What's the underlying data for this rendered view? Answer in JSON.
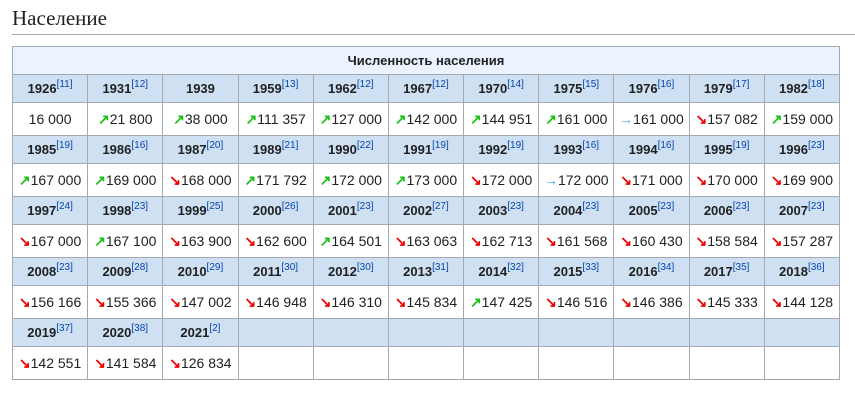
{
  "heading": "Население",
  "table_title": "Численность населения",
  "colors": {
    "up": "#19c019",
    "down": "#ee0000",
    "same": "#3aa6f0"
  },
  "rows": [
    [
      {
        "year": "1926",
        "ref": "[11]",
        "trend": "none",
        "value": "16 000"
      },
      {
        "year": "1931",
        "ref": "[12]",
        "trend": "up",
        "value": "21 800"
      },
      {
        "year": "1939",
        "ref": "",
        "trend": "up",
        "value": "38 000"
      },
      {
        "year": "1959",
        "ref": "[13]",
        "trend": "up",
        "value": "111 357"
      },
      {
        "year": "1962",
        "ref": "[12]",
        "trend": "up",
        "value": "127 000"
      },
      {
        "year": "1967",
        "ref": "[12]",
        "trend": "up",
        "value": "142 000"
      },
      {
        "year": "1970",
        "ref": "[14]",
        "trend": "up",
        "value": "144 951"
      },
      {
        "year": "1975",
        "ref": "[15]",
        "trend": "up",
        "value": "161 000"
      },
      {
        "year": "1976",
        "ref": "[16]",
        "trend": "same",
        "value": "161 000"
      },
      {
        "year": "1979",
        "ref": "[17]",
        "trend": "down",
        "value": "157 082"
      },
      {
        "year": "1982",
        "ref": "[18]",
        "trend": "up",
        "value": "159 000"
      }
    ],
    [
      {
        "year": "1985",
        "ref": "[19]",
        "trend": "up",
        "value": "167 000"
      },
      {
        "year": "1986",
        "ref": "[16]",
        "trend": "up",
        "value": "169 000"
      },
      {
        "year": "1987",
        "ref": "[20]",
        "trend": "down",
        "value": "168 000"
      },
      {
        "year": "1989",
        "ref": "[21]",
        "trend": "up",
        "value": "171 792"
      },
      {
        "year": "1990",
        "ref": "[22]",
        "trend": "up",
        "value": "172 000"
      },
      {
        "year": "1991",
        "ref": "[19]",
        "trend": "up",
        "value": "173 000"
      },
      {
        "year": "1992",
        "ref": "[19]",
        "trend": "down",
        "value": "172 000"
      },
      {
        "year": "1993",
        "ref": "[16]",
        "trend": "same",
        "value": "172 000"
      },
      {
        "year": "1994",
        "ref": "[16]",
        "trend": "down",
        "value": "171 000"
      },
      {
        "year": "1995",
        "ref": "[19]",
        "trend": "down",
        "value": "170 000"
      },
      {
        "year": "1996",
        "ref": "[23]",
        "trend": "down",
        "value": "169 900"
      }
    ],
    [
      {
        "year": "1997",
        "ref": "[24]",
        "trend": "down",
        "value": "167 000"
      },
      {
        "year": "1998",
        "ref": "[23]",
        "trend": "up",
        "value": "167 100"
      },
      {
        "year": "1999",
        "ref": "[25]",
        "trend": "down",
        "value": "163 900"
      },
      {
        "year": "2000",
        "ref": "[26]",
        "trend": "down",
        "value": "162 600"
      },
      {
        "year": "2001",
        "ref": "[23]",
        "trend": "up",
        "value": "164 501"
      },
      {
        "year": "2002",
        "ref": "[27]",
        "trend": "down",
        "value": "163 063"
      },
      {
        "year": "2003",
        "ref": "[23]",
        "trend": "down",
        "value": "162 713"
      },
      {
        "year": "2004",
        "ref": "[23]",
        "trend": "down",
        "value": "161 568"
      },
      {
        "year": "2005",
        "ref": "[23]",
        "trend": "down",
        "value": "160 430"
      },
      {
        "year": "2006",
        "ref": "[23]",
        "trend": "down",
        "value": "158 584"
      },
      {
        "year": "2007",
        "ref": "[23]",
        "trend": "down",
        "value": "157 287"
      }
    ],
    [
      {
        "year": "2008",
        "ref": "[23]",
        "trend": "down",
        "value": "156 166"
      },
      {
        "year": "2009",
        "ref": "[28]",
        "trend": "down",
        "value": "155 366"
      },
      {
        "year": "2010",
        "ref": "[29]",
        "trend": "down",
        "value": "147 002"
      },
      {
        "year": "2011",
        "ref": "[30]",
        "trend": "down",
        "value": "146 948"
      },
      {
        "year": "2012",
        "ref": "[30]",
        "trend": "down",
        "value": "146 310"
      },
      {
        "year": "2013",
        "ref": "[31]",
        "trend": "down",
        "value": "145 834"
      },
      {
        "year": "2014",
        "ref": "[32]",
        "trend": "up",
        "value": "147 425"
      },
      {
        "year": "2015",
        "ref": "[33]",
        "trend": "down",
        "value": "146 516"
      },
      {
        "year": "2016",
        "ref": "[34]",
        "trend": "down",
        "value": "146 386"
      },
      {
        "year": "2017",
        "ref": "[35]",
        "trend": "down",
        "value": "145 333"
      },
      {
        "year": "2018",
        "ref": "[36]",
        "trend": "down",
        "value": "144 128"
      }
    ],
    [
      {
        "year": "2019",
        "ref": "[37]",
        "trend": "down",
        "value": "142 551"
      },
      {
        "year": "2020",
        "ref": "[38]",
        "trend": "down",
        "value": "141 584"
      },
      {
        "year": "2021",
        "ref": "[2]",
        "trend": "down",
        "value": "126 834"
      }
    ]
  ]
}
